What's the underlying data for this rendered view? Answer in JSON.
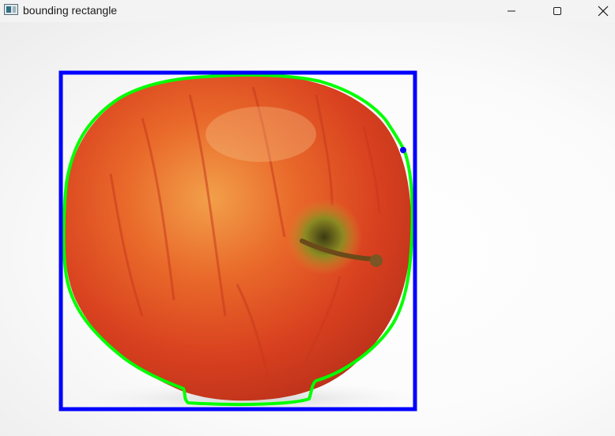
{
  "window": {
    "title": "bounding rectangle",
    "icon": "opencv-window-icon"
  },
  "controls": {
    "minimize_icon": "minimize-icon",
    "maximize_icon": "maximize-icon",
    "close_icon": "close-icon"
  },
  "image": {
    "subject": "apple",
    "bounding_rect_color": "#0000ff",
    "contour_color": "#00ff00"
  }
}
